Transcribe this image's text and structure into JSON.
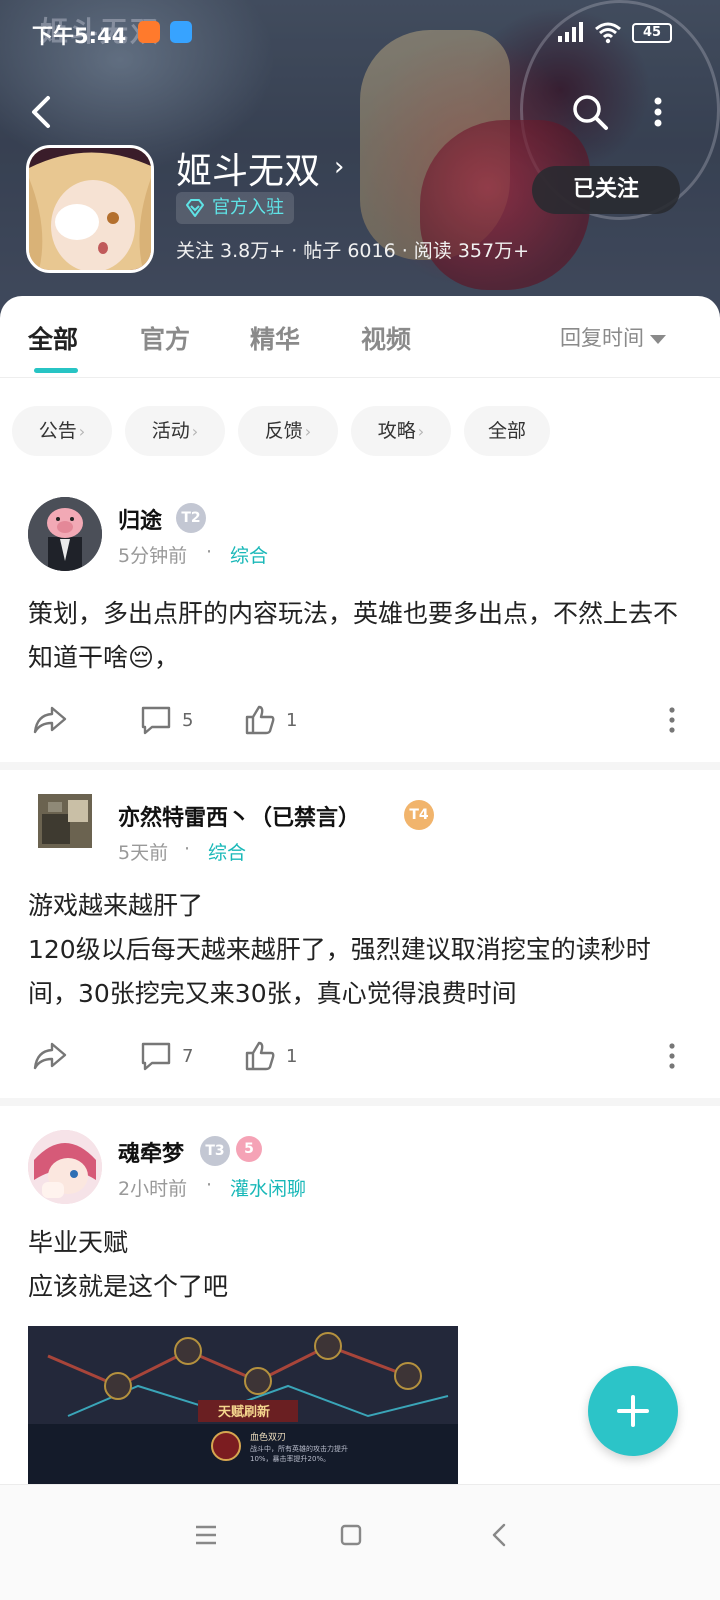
{
  "status_bar": {
    "time": "下午5:44",
    "battery": "45"
  },
  "banner": {
    "logo_text": "姬斗无双"
  },
  "header": {
    "title": "姬斗无双",
    "official_badge": "官方入驻",
    "stats": "关注 3.8万+ · 帖子 6016 · 阅读 357万+",
    "follow_button": "已关注"
  },
  "tabs": [
    {
      "label": "全部",
      "active": true
    },
    {
      "label": "官方",
      "active": false
    },
    {
      "label": "精华",
      "active": false
    },
    {
      "label": "视频",
      "active": false
    }
  ],
  "sort": {
    "label": "回复时间"
  },
  "chips": [
    {
      "label": "公告",
      "has_arrow": true
    },
    {
      "label": "活动",
      "has_arrow": true
    },
    {
      "label": "反馈",
      "has_arrow": true
    },
    {
      "label": "攻略",
      "has_arrow": true
    },
    {
      "label": "全部",
      "has_arrow": false
    }
  ],
  "posts": [
    {
      "username": "归途",
      "level": "T2",
      "time": "5分钟前",
      "category": "综合",
      "text": "策划，多出点肝的内容玩法，英雄也要多出点，不然上去不知道干啥😔，",
      "comments": "5",
      "likes": "1"
    },
    {
      "username": "亦然特雷西丶（已禁言）",
      "level": "T4",
      "time": "5天前",
      "category": "综合",
      "text": "游戏越来越肝了\n120级以后每天越来越肝了，强烈建议取消挖宝的读秒时间，30张挖完又来30张，真心觉得浪费时间",
      "comments": "7",
      "likes": "1"
    },
    {
      "username": "魂牵梦",
      "level": "T3",
      "extra_badge": "5",
      "time": "2小时前",
      "category": "灌水闲聊",
      "text": "毕业天赋\n应该就是这个了吧",
      "image_banner_text": "天赋刷新",
      "image_skill_name": "血色双刃",
      "image_skill_desc": "战斗中，所有英雄的攻击力提升10%，暴击率提升20%。"
    }
  ],
  "colors": {
    "accent": "#27c4c4",
    "link": "#19b8b8",
    "fab": "#2cc4c8"
  },
  "icons": [
    "back-icon",
    "search-icon",
    "more-vertical-icon",
    "chevron-right-icon",
    "diamond-icon",
    "share-icon",
    "comment-icon",
    "like-icon",
    "plus-icon",
    "menu-icon",
    "home-icon",
    "nav-back-icon"
  ]
}
